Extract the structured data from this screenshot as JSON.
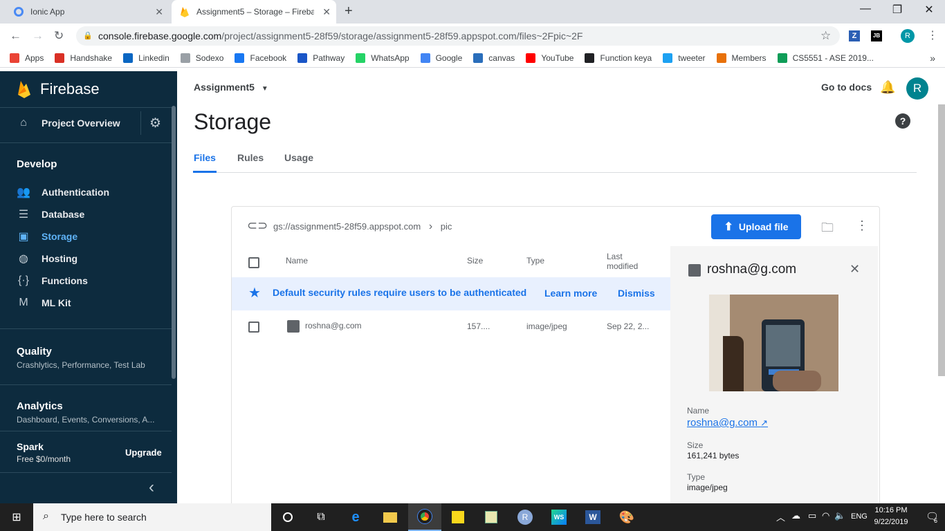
{
  "browser": {
    "tabs": [
      {
        "title": "Ionic App"
      },
      {
        "title": "Assignment5 – Storage – Firebase"
      }
    ],
    "url_host": "console.firebase.google.com",
    "url_path": "/project/assignment5-28f59/storage/assignment5-28f59.appspot.com/files~2Fpic~2F",
    "profile_initial": "R",
    "bookmarks": [
      {
        "label": "Apps",
        "color": "#ea4335"
      },
      {
        "label": "Handshake",
        "color": "#d93025"
      },
      {
        "label": "Linkedin",
        "color": "#0a66c2"
      },
      {
        "label": "Sodexo",
        "color": "#9aa0a6"
      },
      {
        "label": "Facebook",
        "color": "#1877f2"
      },
      {
        "label": "Pathway",
        "color": "#1a56c7"
      },
      {
        "label": "WhatsApp",
        "color": "#25d366"
      },
      {
        "label": "Google",
        "color": "#4285f4"
      },
      {
        "label": "canvas",
        "color": "#2a6ebb"
      },
      {
        "label": "YouTube",
        "color": "#ff0000"
      },
      {
        "label": "Function keya",
        "color": "#202124"
      },
      {
        "label": "tweeter",
        "color": "#1da1f2"
      },
      {
        "label": "Members",
        "color": "#e8710a"
      },
      {
        "label": "CS5551 - ASE 2019...",
        "color": "#0f9d58"
      }
    ],
    "more_bookmarks": "»"
  },
  "sidebar": {
    "brand": "Firebase",
    "project_overview": "Project Overview",
    "develop_heading": "Develop",
    "develop_items": [
      {
        "label": "Authentication",
        "icon": "people-icon"
      },
      {
        "label": "Database",
        "icon": "database-icon"
      },
      {
        "label": "Storage",
        "icon": "image-icon"
      },
      {
        "label": "Hosting",
        "icon": "globe-icon"
      },
      {
        "label": "Functions",
        "icon": "functions-icon"
      },
      {
        "label": "ML Kit",
        "icon": "mlkit-icon"
      }
    ],
    "quality_heading": "Quality",
    "quality_sub": "Crashlytics, Performance, Test Lab",
    "analytics_heading": "Analytics",
    "analytics_sub": "Dashboard, Events, Conversions, A...",
    "plan_name": "Spark",
    "plan_price": "Free $0/month",
    "upgrade": "Upgrade",
    "collapse": "‹"
  },
  "header": {
    "project": "Assignment5",
    "go_to_docs": "Go to docs",
    "avatar": "R",
    "help": "?"
  },
  "page": {
    "title": "Storage",
    "tabs": [
      "Files",
      "Rules",
      "Usage"
    ],
    "active_tab": "Files"
  },
  "files": {
    "bucket": "gs://assignment5-28f59.appspot.com",
    "separator": "›",
    "folder": "pic",
    "upload_label": "Upload file",
    "columns": {
      "name": "Name",
      "size": "Size",
      "type": "Type",
      "modified_1": "Last",
      "modified_2": "modified"
    },
    "banner": {
      "text": "Default security rules require users to be authenticated",
      "learn_more": "Learn more",
      "dismiss": "Dismiss"
    },
    "rows": [
      {
        "name": "roshna@g.com",
        "size": "157....",
        "type": "image/jpeg",
        "modified": "Sep 22, 2..."
      }
    ]
  },
  "detail": {
    "title": "roshna@g.com",
    "name_label": "Name",
    "name_value": "roshna@g.com",
    "size_label": "Size",
    "size_value": "161,241 bytes",
    "type_label": "Type",
    "type_value": "image/jpeg"
  },
  "taskbar": {
    "search_placeholder": "Type here to search",
    "lang": "ENG",
    "time": "10:16 PM",
    "date": "9/22/2019",
    "notifications": "6"
  }
}
